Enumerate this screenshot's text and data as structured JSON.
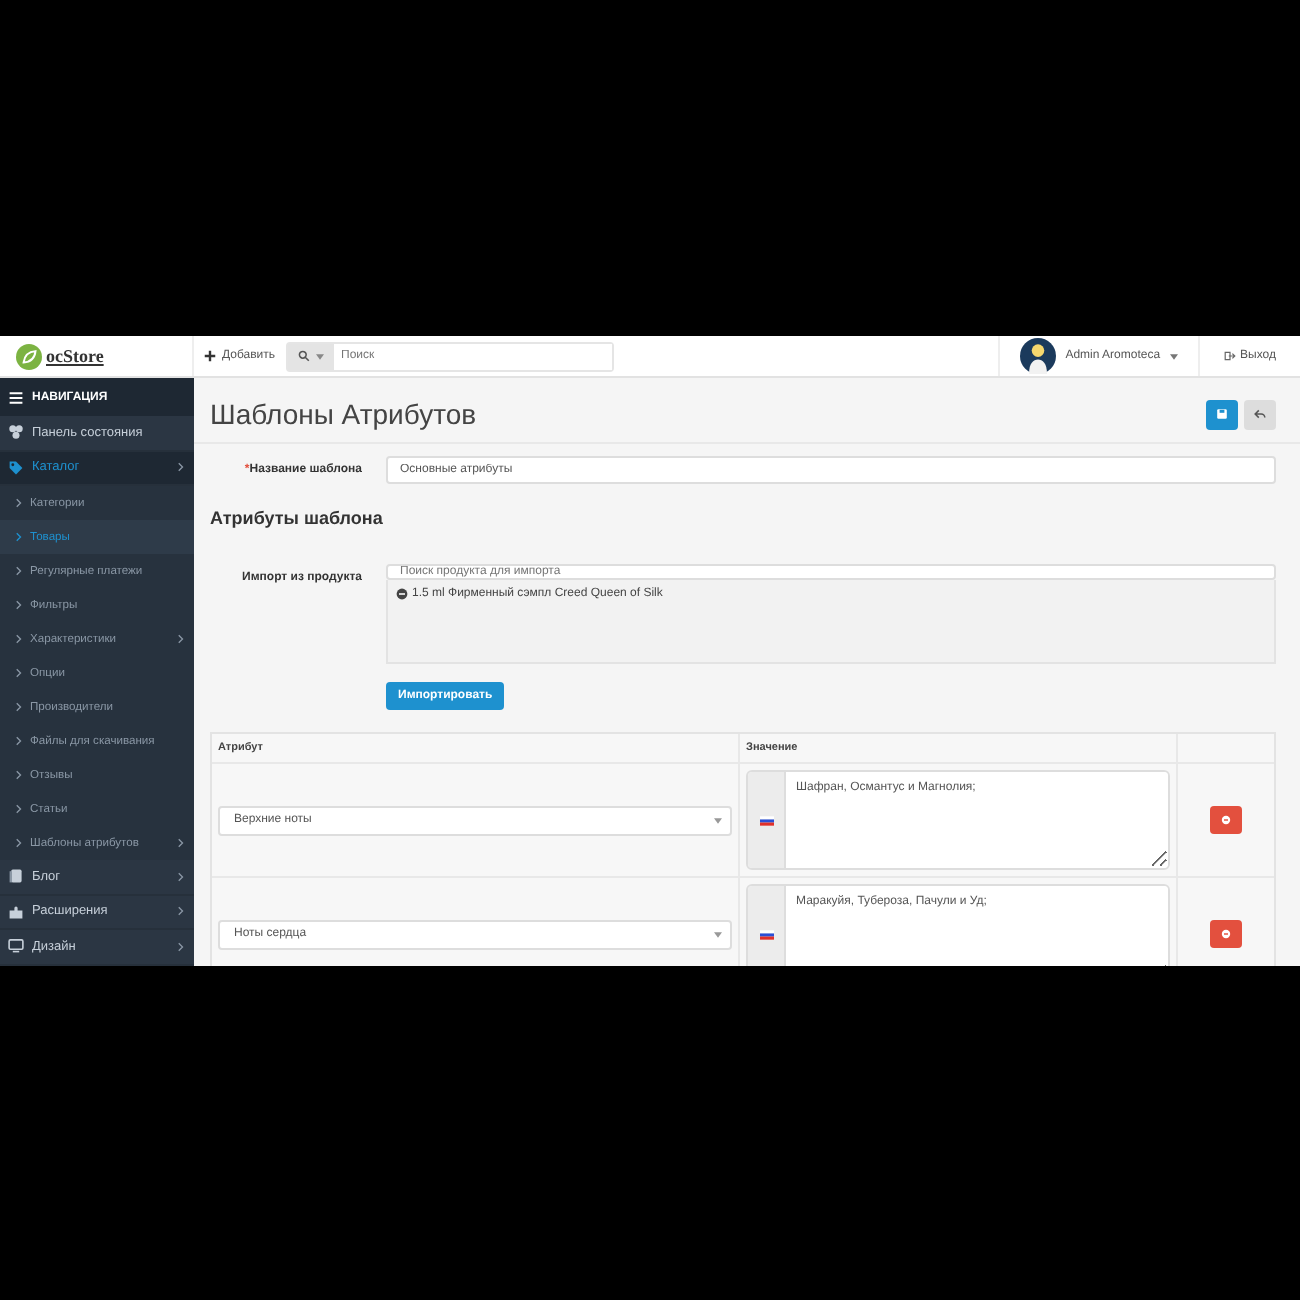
{
  "header": {
    "logo": "ocStore",
    "add_button": "Добавить",
    "search": {
      "placeholder": "Поиск"
    },
    "user": "Admin Aromoteca",
    "logout": "Выход"
  },
  "sidebar": {
    "title": "НАВИГАЦИЯ",
    "items": [
      {
        "label": "Панель состояния",
        "selected": false,
        "submenu": false
      },
      {
        "label": "Каталог",
        "selected": true,
        "submenu": true,
        "children": [
          {
            "label": "Категории",
            "selected": false,
            "submenu": false
          },
          {
            "label": "Товары",
            "selected": true,
            "submenu": false
          },
          {
            "label": "Регулярные платежи",
            "selected": false,
            "submenu": false
          },
          {
            "label": "Фильтры",
            "selected": false,
            "submenu": false
          },
          {
            "label": "Характеристики",
            "selected": false,
            "submenu": true
          },
          {
            "label": "Опции",
            "selected": false,
            "submenu": false
          },
          {
            "label": "Производители",
            "selected": false,
            "submenu": false
          },
          {
            "label": "Файлы для скачивания",
            "selected": false,
            "submenu": false
          },
          {
            "label": "Отзывы",
            "selected": false,
            "submenu": false
          },
          {
            "label": "Статьи",
            "selected": false,
            "submenu": false
          },
          {
            "label": "Шаблоны атрибутов",
            "selected": false,
            "submenu": true
          }
        ]
      },
      {
        "label": "Блог",
        "selected": false,
        "submenu": true
      },
      {
        "label": "Расширения",
        "selected": false,
        "submenu": true
      },
      {
        "label": "Дизайн",
        "selected": false,
        "submenu": true
      }
    ]
  },
  "page": {
    "title": "Шаблоны Атрибутов",
    "name_field": {
      "required_mark": "*",
      "label": "Название шаблона",
      "value": "Основные атрибуты"
    },
    "section_title": "Атрибуты шаблона",
    "import_field": {
      "label": "Импорт из продукта",
      "placeholder": "Поиск продукта для импорта",
      "products": [
        "1.5 ml Фирменный сэмпл Creed Queen of Silk"
      ]
    },
    "import_button": "Импортировать",
    "table": {
      "columns": [
        "Атрибут",
        "Значение"
      ],
      "rows": [
        {
          "attribute": "Верхние ноты",
          "value": "Шафран, Османтус и Магнолия;"
        },
        {
          "attribute": "Ноты сердца",
          "value": "Маракуйя, Тубероза, Пачули и Уд;"
        }
      ]
    }
  }
}
